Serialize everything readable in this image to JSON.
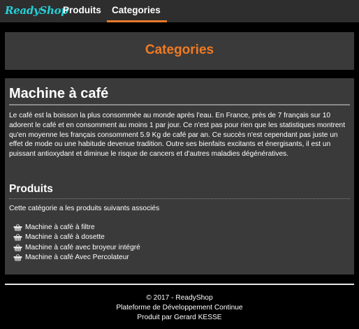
{
  "navbar": {
    "brand": "ReadyShop",
    "links": [
      {
        "label": "Produits"
      },
      {
        "label": "Categories"
      }
    ],
    "accent_color": "#e87a2c"
  },
  "page": {
    "title": "Categories",
    "title_color": "#ef7b24"
  },
  "category": {
    "name": "Machine à café",
    "description": "Le café est la boisson la plus consommée au monde après l'eau. En France, près de 7 français sur 10 adorent le café et en consomment au moins 1 par jour. Ce n'est pas pour rien que les statistiques montrent qu'en moyenne les français consomment 5.9 Kg de café par an. Ce succès n'est cependant pas juste un effet de mode ou une habitude devenue tradition. Outre ses bienfaits excitants et énergisants, il est un puissant antioxydant et diminue le risque de cancers et d'autres maladies dégénératives."
  },
  "products_section": {
    "title": "Produits",
    "intro": "Cette catégorie a les produits suivants associés",
    "icon": "basket-icon",
    "items": [
      {
        "label": "Machine à café à filtre"
      },
      {
        "label": "Machine à café à dosette"
      },
      {
        "label": "Machine à café avec broyeur intégré"
      },
      {
        "label": "Machine à café Avec Percolateur"
      }
    ]
  },
  "footer": {
    "copyright": "© 2017 - ReadyShop",
    "line2": "Plateforme de Développement Continue",
    "line3": "Produit par Gerard KESSE"
  }
}
